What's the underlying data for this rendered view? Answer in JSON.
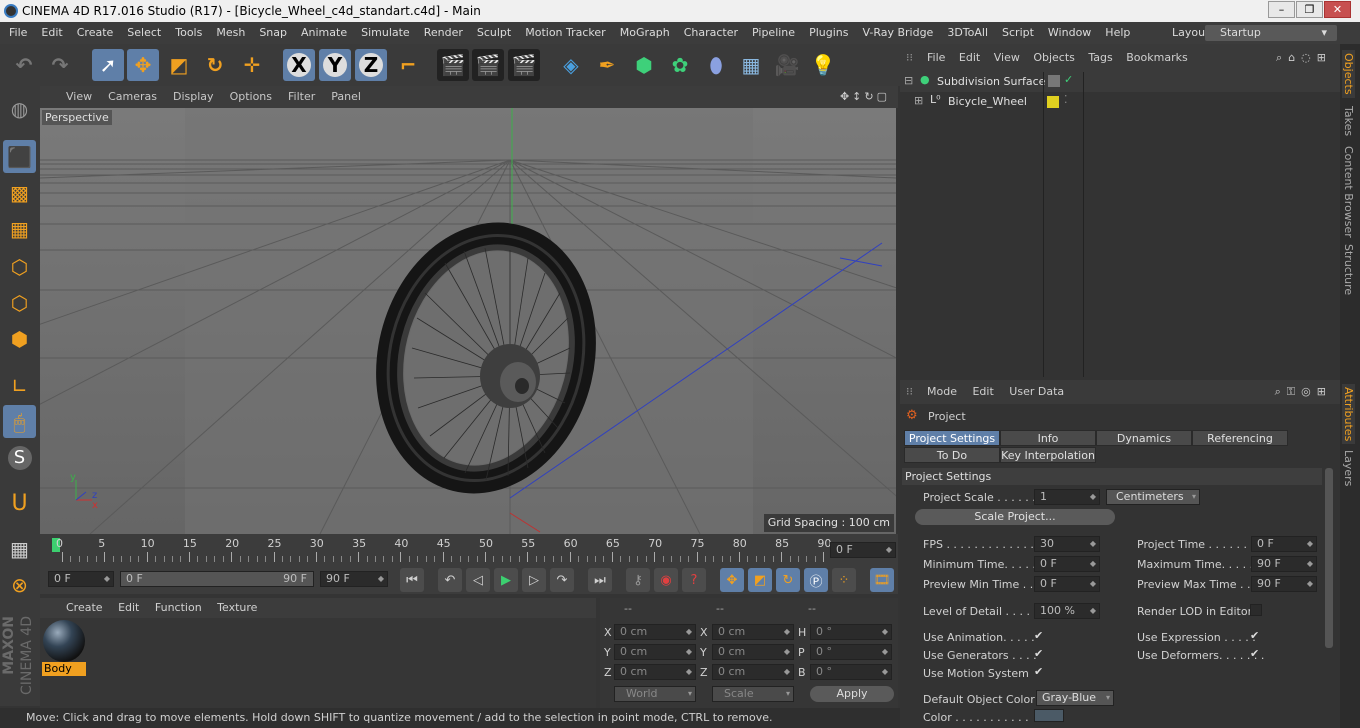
{
  "title": "CINEMA 4D R17.016 Studio (R17) - [Bicycle_Wheel_c4d_standart.c4d] - Main",
  "menu": [
    "File",
    "Edit",
    "Create",
    "Select",
    "Tools",
    "Mesh",
    "Snap",
    "Animate",
    "Simulate",
    "Render",
    "Sculpt",
    "Motion Tracker",
    "MoGraph",
    "Character",
    "Pipeline",
    "Plugins",
    "V-Ray Bridge",
    "3DToAll",
    "Script",
    "Window",
    "Help"
  ],
  "layout": {
    "label": "Layout:",
    "value": "Startup"
  },
  "viewport": {
    "menu": [
      "View",
      "Cameras",
      "Display",
      "Options",
      "Filter",
      "Panel"
    ],
    "label": "Perspective",
    "grid_spacing": "Grid Spacing : 100 cm"
  },
  "timeline": {
    "ticks": [
      "0",
      "5",
      "10",
      "15",
      "20",
      "25",
      "30",
      "35",
      "40",
      "45",
      "50",
      "55",
      "60",
      "65",
      "70",
      "75",
      "80",
      "85",
      "90"
    ],
    "current": "0 F",
    "start": "0 F",
    "range_start": "0 F",
    "range_end": "90 F",
    "end": "90 F"
  },
  "material_manager": {
    "menu": [
      "Create",
      "Edit",
      "Function",
      "Texture"
    ],
    "material_name": "Body"
  },
  "coordinates": {
    "headers": [
      "--",
      "--",
      "--"
    ],
    "rows": [
      {
        "a": "X",
        "av": "0 cm",
        "b": "X",
        "bv": "0 cm",
        "c": "H",
        "cv": "0 °"
      },
      {
        "a": "Y",
        "av": "0 cm",
        "b": "Y",
        "bv": "0 cm",
        "c": "P",
        "cv": "0 °"
      },
      {
        "a": "Z",
        "av": "0 cm",
        "b": "Z",
        "bv": "0 cm",
        "c": "B",
        "cv": "0 °"
      }
    ],
    "world": "World",
    "scale": "Scale",
    "apply": "Apply"
  },
  "status": "Move: Click and drag to move elements. Hold down SHIFT to quantize movement / add to the selection in point mode, CTRL to remove.",
  "objects": {
    "menu": [
      "File",
      "Edit",
      "View",
      "Objects",
      "Tags",
      "Bookmarks"
    ],
    "items": [
      "Subdivision Surface",
      "Bicycle_Wheel"
    ]
  },
  "attributes": {
    "menu": [
      "Mode",
      "Edit",
      "User Data"
    ],
    "object": "Project",
    "tabs": [
      "Project Settings",
      "Info",
      "Dynamics",
      "Referencing",
      "To Do",
      "Key Interpolation"
    ],
    "section": "Project Settings",
    "project_scale_label": "Project Scale . . . . . .",
    "project_scale": "1",
    "unit": "Centimeters",
    "scale_project": "Scale Project...",
    "fps_label": "FPS . . . . . . . . . . . . . .",
    "fps": "30",
    "project_time_label": "Project Time . . . . . . . .",
    "project_time": "0 F",
    "min_time_label": "Minimum Time. . . . .",
    "min_time": "0 F",
    "max_time_label": "Maximum Time. . . . . .",
    "max_time": "90 F",
    "prev_min_label": "Preview Min Time . .",
    "prev_min": "0 F",
    "prev_max_label": "Preview Max Time . . .",
    "prev_max": "90 F",
    "lod_label": "Level of Detail . . . . .",
    "lod": "100 %",
    "render_lod_label": "Render LOD in Editor",
    "use_anim": "Use Animation. . . . .",
    "use_expr": "Use Expression . . . . .",
    "use_gen": "Use Generators . . . .",
    "use_def": "Use Deformers. . . . . . .",
    "use_motion": "Use Motion System",
    "def_color_label": "Default Object Color",
    "def_color": "Gray-Blue",
    "color_label": "Color . . . . . . . . . . ."
  },
  "right_tabs": [
    "Objects",
    "Takes",
    "Content Browser",
    "Structure",
    "Attributes",
    "Layers"
  ],
  "brand": [
    "MAXON",
    "CINEMA 4D"
  ]
}
